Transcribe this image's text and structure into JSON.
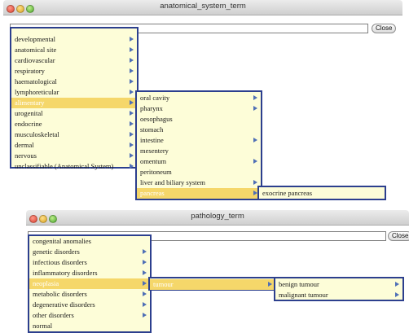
{
  "colors": {
    "menu_background": "#fdfdd8",
    "menu_border": "#2c3f8e",
    "highlight": "#f5d76a",
    "submenu_arrow": "#4f6fb6"
  },
  "icons": [
    "close-light-icon",
    "minimize-light-icon",
    "zoom-light-icon",
    "submenu-arrow-icon"
  ],
  "window1": {
    "title": "anatomical_system_term",
    "close_label": "Close",
    "field_value": "",
    "menu1": {
      "items": [
        {
          "label": "developmental",
          "submenu": true,
          "highlighted": false
        },
        {
          "label": "anatomical site",
          "submenu": true,
          "highlighted": false
        },
        {
          "label": "cardiovascular",
          "submenu": true,
          "highlighted": false
        },
        {
          "label": "respiratory",
          "submenu": true,
          "highlighted": false
        },
        {
          "label": "haematological",
          "submenu": true,
          "highlighted": false
        },
        {
          "label": "lymphoreticular",
          "submenu": true,
          "highlighted": false
        },
        {
          "label": "alimentary",
          "submenu": true,
          "highlighted": true
        },
        {
          "label": "urogenital",
          "submenu": true,
          "highlighted": false
        },
        {
          "label": "endocrine",
          "submenu": true,
          "highlighted": false
        },
        {
          "label": "musculoskeletal",
          "submenu": true,
          "highlighted": false
        },
        {
          "label": "dermal",
          "submenu": true,
          "highlighted": false
        },
        {
          "label": "nervous",
          "submenu": true,
          "highlighted": false
        },
        {
          "label": "unclassifiable (Anatomical System)",
          "submenu": true,
          "highlighted": false
        }
      ]
    },
    "menu2": {
      "items": [
        {
          "label": "oral cavity",
          "submenu": true,
          "highlighted": false
        },
        {
          "label": "pharynx",
          "submenu": true,
          "highlighted": false
        },
        {
          "label": "oesophagus",
          "submenu": false,
          "highlighted": false
        },
        {
          "label": "stomach",
          "submenu": false,
          "highlighted": false
        },
        {
          "label": "intestine",
          "submenu": true,
          "highlighted": false
        },
        {
          "label": "mesentery",
          "submenu": false,
          "highlighted": false
        },
        {
          "label": "omentum",
          "submenu": true,
          "highlighted": false
        },
        {
          "label": "peritoneum",
          "submenu": false,
          "highlighted": false
        },
        {
          "label": "liver and biliary system",
          "submenu": true,
          "highlighted": false
        },
        {
          "label": "pancreas",
          "submenu": true,
          "highlighted": true
        }
      ]
    },
    "menu3": {
      "items": [
        {
          "label": "exocrine pancreas",
          "submenu": false,
          "highlighted": false
        }
      ]
    }
  },
  "window2": {
    "title": "pathology_term",
    "close_label": "Close",
    "field_value": "",
    "menu1": {
      "items": [
        {
          "label": "congenital anomalies",
          "submenu": false,
          "highlighted": false
        },
        {
          "label": "genetic disorders",
          "submenu": true,
          "highlighted": false
        },
        {
          "label": "infectious disorders",
          "submenu": true,
          "highlighted": false
        },
        {
          "label": "inflammatory disorders",
          "submenu": true,
          "highlighted": false
        },
        {
          "label": "neoplasia",
          "submenu": true,
          "highlighted": true
        },
        {
          "label": "metabolic disorders",
          "submenu": true,
          "highlighted": false
        },
        {
          "label": "degenerative disorders",
          "submenu": true,
          "highlighted": false
        },
        {
          "label": "other disorders",
          "submenu": true,
          "highlighted": false
        },
        {
          "label": "normal",
          "submenu": false,
          "highlighted": false
        }
      ]
    },
    "menu2": {
      "items": [
        {
          "label": "tumour",
          "submenu": true,
          "highlighted": true
        }
      ]
    },
    "menu3": {
      "items": [
        {
          "label": "benign tumour",
          "submenu": true,
          "highlighted": false
        },
        {
          "label": "malignant tumour",
          "submenu": true,
          "highlighted": false
        }
      ]
    }
  }
}
